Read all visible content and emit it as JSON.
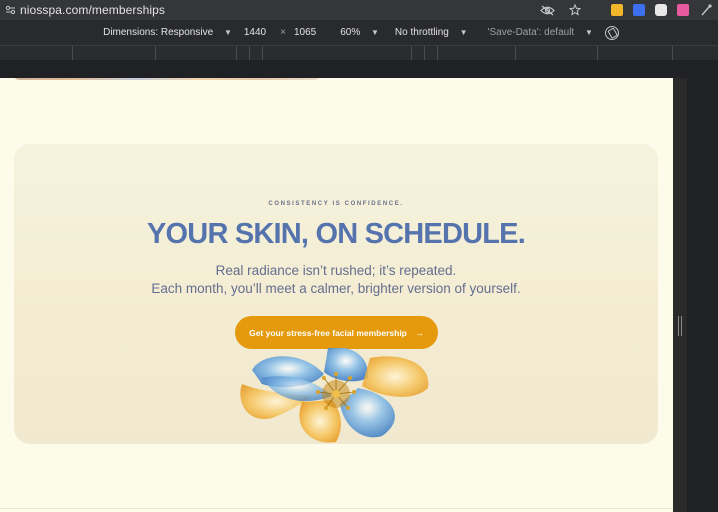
{
  "browser": {
    "url": "niosspa.com/memberships",
    "icons": [
      "site-info-icon",
      "eye-off-icon",
      "star-icon",
      "extension-icon",
      "extension-icon",
      "extension-icon",
      "extension-icon",
      "eyedropper-icon"
    ],
    "extension_colors": [
      "#f2b62b",
      "#3c6ff0",
      "#e8e8e8",
      "#e85a9f"
    ]
  },
  "devtools": {
    "dimensions_label": "Dimensions: Responsive",
    "width": "1440",
    "times": "×",
    "height": "1065",
    "zoom": "60%",
    "throttling": "No throttling",
    "save_data": "'Save-Data': default"
  },
  "hero": {
    "eyebrow": "CONSISTENCY IS CONFIDENCE.",
    "headline": "YOUR SKIN, ON SCHEDULE.",
    "line1": "Real radiance isn’t rushed; it’s repeated.",
    "line2": "Each month, you’ll meet a calmer, brighter version of yourself.",
    "cta_label": "Get your stress-free facial membership",
    "cta_arrow": "→"
  },
  "colors": {
    "page_bg": "#fdfbea",
    "card_bg": "#f4eed6",
    "headline": "#5573ad",
    "cta_bg": "#e49a0c"
  }
}
